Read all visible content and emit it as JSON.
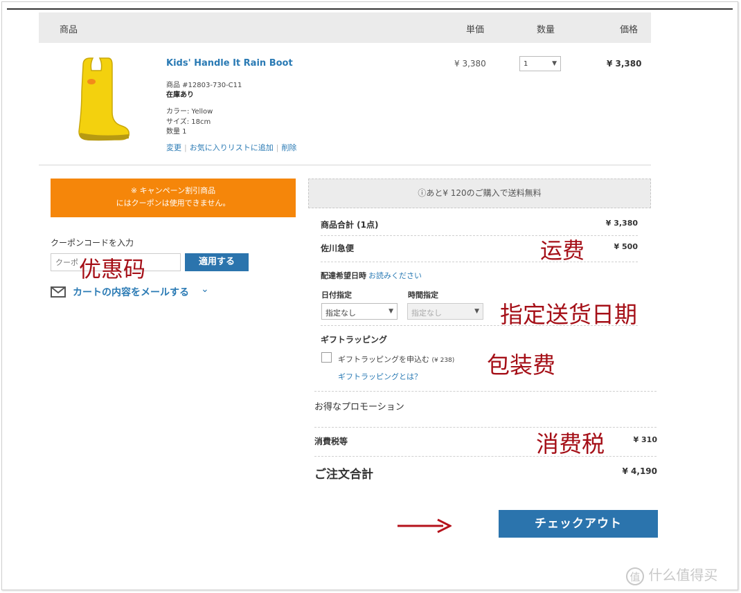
{
  "table": {
    "headers": {
      "product": "商品",
      "unit_price": "単価",
      "quantity": "数量",
      "price": "価格"
    }
  },
  "product": {
    "name": "Kids' Handle It Rain Boot",
    "sku": "商品 #12803-730-C11",
    "stock": "在庫あり",
    "color": "カラー: Yellow",
    "size": "サイズ: 18cm",
    "qty_text": "数量 1",
    "unit_price": "¥ 3,380",
    "qty_value": "1",
    "price": "¥ 3,380",
    "links": {
      "change": "変更",
      "wishlist": "お気に入りリストに追加",
      "delete": "削除"
    }
  },
  "campaign": {
    "line1": "※ キャンペーン割引商品",
    "line2": "にはクーポンは使用できません。"
  },
  "coupon": {
    "label": "クーポンコードを入力",
    "placeholder": "クーポ",
    "apply": "適用する"
  },
  "mail": {
    "label": "カートの内容をメールする"
  },
  "shipping_notice": "ⓘあと¥ 120のご購入で送料無料",
  "summary": {
    "subtotal_label": "商品合計 (1点)",
    "subtotal_value": "¥ 3,380",
    "shipping_label": "佐川急便",
    "shipping_value": "¥ 500",
    "delivery_title": "配達希望日時",
    "delivery_link": "お読みください",
    "date_label": "日付指定",
    "date_value": "指定なし",
    "time_label": "時間指定",
    "time_value": "指定なし",
    "gift_title": "ギフトラッピング",
    "gift_option": "ギフトラッピングを申込む",
    "gift_fee": "(¥ 238)",
    "gift_what": "ギフトラッピングとは？",
    "promo_label": "お得なプロモーション",
    "tax_label": "消費税等",
    "tax_value": "¥ 310",
    "total_label": "ご注文合計",
    "total_value": "¥ 4,190"
  },
  "checkout": "チェックアウト",
  "annotations": {
    "coupon": "优惠码",
    "shipping": "运费",
    "delivery_date": "指定送货日期",
    "wrapping": "包装费",
    "tax": "消费税"
  },
  "watermark": {
    "mark": "值",
    "text": "什么值得买"
  },
  "colors": {
    "link": "#2a7ab4",
    "button": "#2b74ad",
    "campaign": "#f5860a",
    "annotation": "#a51018"
  }
}
